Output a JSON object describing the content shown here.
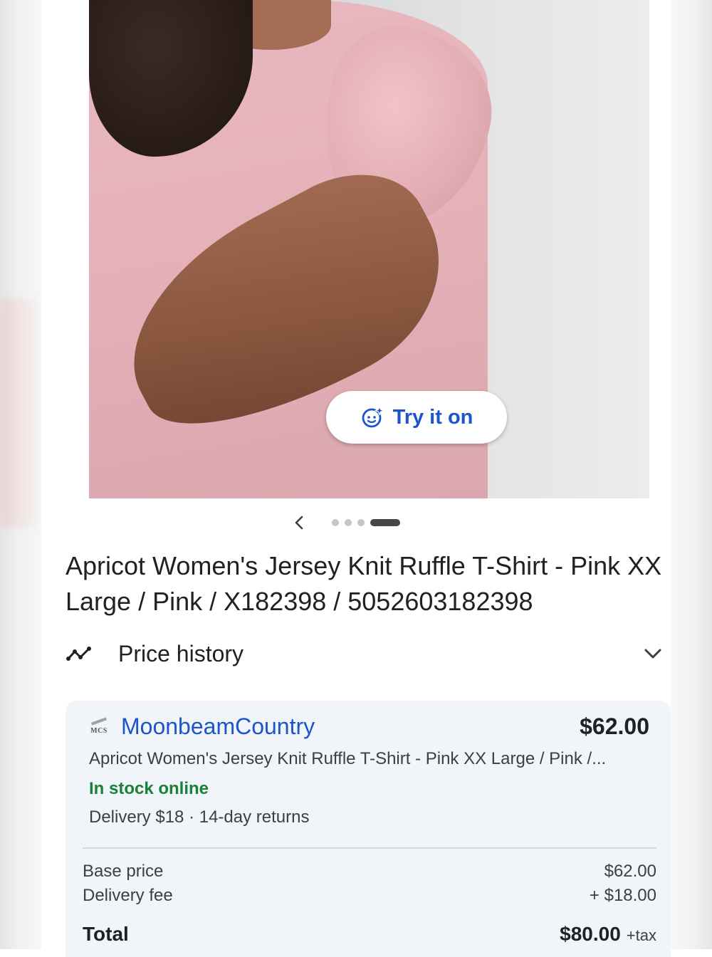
{
  "product": {
    "try_on_label": "Try it on",
    "title": "Apricot Women's Jersey Knit Ruffle T-Shirt - Pink XX Large / Pink / X182398 / 5052603182398",
    "image_dots": 4,
    "active_dot": 4
  },
  "price_history": {
    "label": "Price history",
    "icon": "trending-line-icon",
    "expand_icon": "chevron-down-icon"
  },
  "offer": {
    "merchant_logo_text": "MCS",
    "merchant_name": "MoonbeamCountry",
    "price": "$62.00",
    "description": "Apricot Women's Jersey Knit Ruffle T-Shirt - Pink XX Large / Pink /...",
    "stock_status": "In stock online",
    "delivery": "Delivery $18 · 14-day returns",
    "breakdown": {
      "base_price_label": "Base price",
      "base_price_value": "$62.00",
      "delivery_fee_label": "Delivery fee",
      "delivery_fee_value": "+ $18.00",
      "total_label": "Total",
      "total_value": "$80.00",
      "tax_label": "+tax"
    }
  },
  "colors": {
    "link_blue": "#1a56c9",
    "stock_green": "#188038",
    "card_bg": "#f1f4f8"
  }
}
